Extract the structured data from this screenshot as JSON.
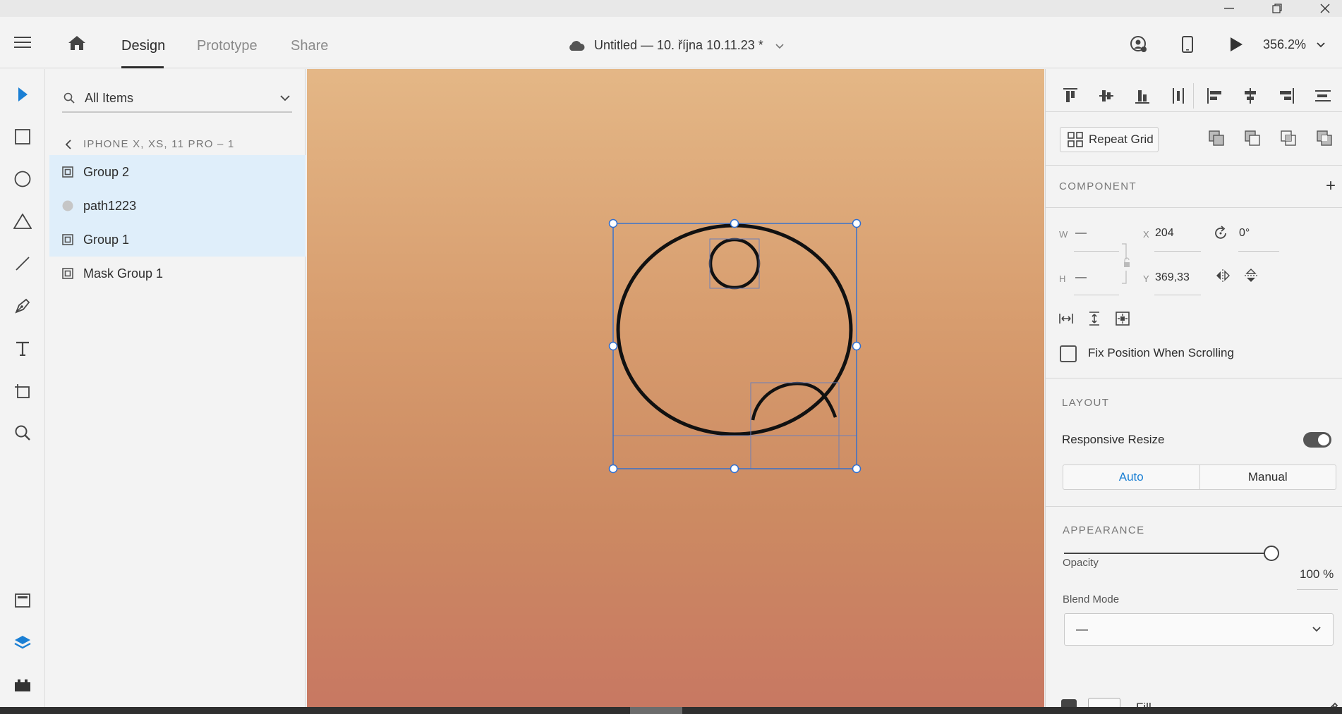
{
  "window": {
    "minimize_icon": "minimize-icon",
    "restore_icon": "restore-icon",
    "close_icon": "close-icon"
  },
  "appbar": {
    "tabs": [
      {
        "label": "Design",
        "active": true
      },
      {
        "label": "Prototype",
        "active": false
      },
      {
        "label": "Share",
        "active": false
      }
    ],
    "document_title": "Untitled — 10. října 10.11.23 *",
    "zoom": "356.2%"
  },
  "tools": [
    "select-tool",
    "rectangle-tool",
    "ellipse-tool",
    "polygon-tool",
    "line-tool",
    "pen-tool",
    "text-tool",
    "artboard-tool",
    "zoom-tool",
    "assets-panel",
    "layers-panel",
    "plugins-panel"
  ],
  "layers": {
    "search_value": "All Items",
    "breadcrumb": "IPHONE X, XS, 11 PRO – 1",
    "items": [
      {
        "label": "Group 2",
        "type": "group",
        "selected": true
      },
      {
        "label": "path1223",
        "type": "path",
        "selected": true
      },
      {
        "label": "Group 1",
        "type": "group",
        "selected": true
      },
      {
        "label": "Mask Group 1",
        "type": "mask-group",
        "selected": false
      }
    ]
  },
  "inspector": {
    "repeat_grid_label": "Repeat Grid",
    "component_title": "COMPONENT",
    "w_label": "W",
    "w_value": "—",
    "h_label": "H",
    "h_value": "—",
    "x_label": "X",
    "x_value": "204",
    "y_label": "Y",
    "y_value": "369,33",
    "rotation_value": "0°",
    "fix_position_label": "Fix Position When Scrolling",
    "layout_title": "LAYOUT",
    "responsive_resize_label": "Responsive Resize",
    "responsive_resize_on": true,
    "auto_label": "Auto",
    "manual_label": "Manual",
    "appearance_title": "APPEARANCE",
    "opacity_label": "Opacity",
    "opacity_value": "100 %",
    "blend_mode_label": "Blend Mode",
    "blend_mode_value": "—",
    "fill_label": "Fill"
  },
  "colors": {
    "accent": "#1a7fd4",
    "selection": "#2f6fd1",
    "canvas_top": "#e4b786",
    "canvas_bottom": "#c87862"
  }
}
